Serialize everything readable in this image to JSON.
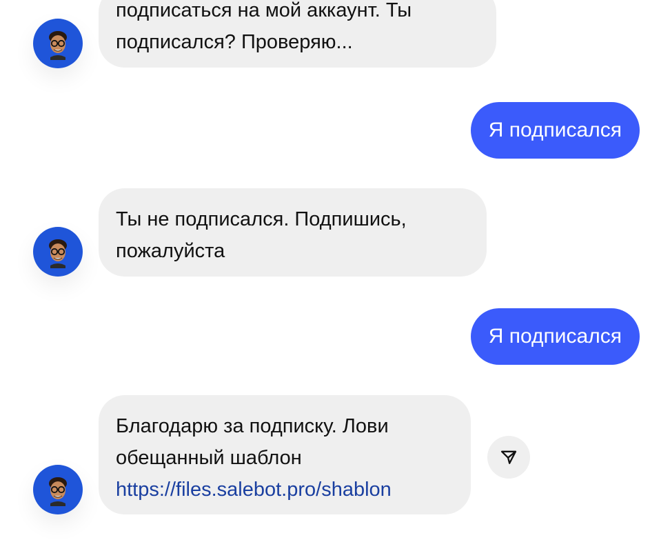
{
  "chat": {
    "messages": [
      {
        "sender": "bot",
        "lines": [
          "подписаться на мой аккаунт. Ты",
          "подписался? Проверяю..."
        ]
      },
      {
        "sender": "user",
        "text": "Я подписался"
      },
      {
        "sender": "bot",
        "lines": [
          "Ты не подписался. Подпишись,",
          "пожалуйста"
        ]
      },
      {
        "sender": "user",
        "text": "Я подписался"
      },
      {
        "sender": "bot",
        "lines": [
          "Благодарю за подписку. Лови",
          "обещанный шаблон"
        ],
        "link": "https://files.salebot.pro/shablon"
      }
    ]
  },
  "colors": {
    "incoming_bubble": "#efefef",
    "outgoing_bubble": "#3b5bfb",
    "avatar_background": "#1f55d9",
    "link": "#1a3fa0"
  },
  "icons": {
    "avatar": "memoji-avatar-icon",
    "share": "send-paper-plane-icon"
  }
}
